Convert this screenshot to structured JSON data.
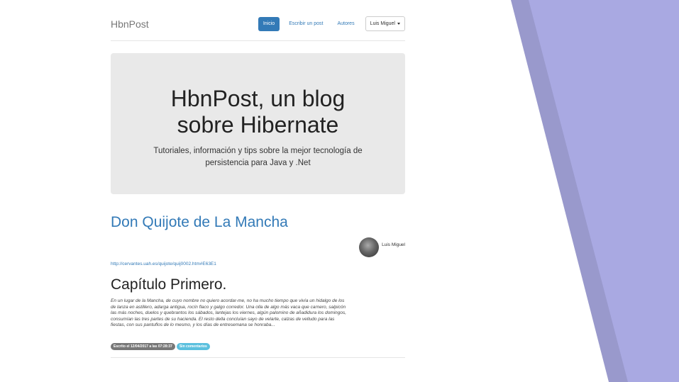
{
  "colors": {
    "accent": "#337ab7",
    "deco_light": "#a9a9e2",
    "deco_dark": "#9999cc",
    "badge_info": "#5bc0de",
    "badge_default": "#777777",
    "jumbotron_bg": "#e9e9e9"
  },
  "navbar": {
    "brand": "HbnPost",
    "items": [
      {
        "label": "Inicio",
        "active": true
      },
      {
        "label": "Escribir un post",
        "active": false
      },
      {
        "label": "Autores",
        "active": false
      }
    ],
    "user_menu": "Luis Miguel"
  },
  "jumbotron": {
    "title_line1": "HbnPost, un blog",
    "title_line2": "sobre Hibernate",
    "subtitle_line1": "Tutoriales, información y tips sobre la mejor tecnología de",
    "subtitle_line2": "persistencia para Java y .Net"
  },
  "post": {
    "title": "Don Quijote de La Mancha",
    "author": "Luis Miguel",
    "avatar_icon": "user-avatar",
    "link": "http://cervantes.uah.es/quijote/quij0002.htm#E63E1",
    "chapter_title": "Capítulo Primero.",
    "excerpt_lines": [
      "En un lugar de la Mancha, de cuyo nombre no quiero acordar-me, no ha mucho tiempo que vivía un hidalgo de los",
      "de lanza en astillero, adarga antigua, rocín flaco y galgo corredor. Una olla de algo más vaca que carnero, salpicón",
      "las más noches, duelos y quebrantos los sábados, lantejas los viernes, algún palomino de añadidura los domingos,",
      "consumían las tres partes de su hacienda. El resto della concluían sayo de velarte, calzas de velludo para las",
      "fiestas, con sus pantuflos de lo mesmo, y los días de entresemana se honraba..."
    ],
    "written_badge": "Escrito el 12/04/2017 a las 07:28:37",
    "comments_badge": "Sin comentarios"
  }
}
